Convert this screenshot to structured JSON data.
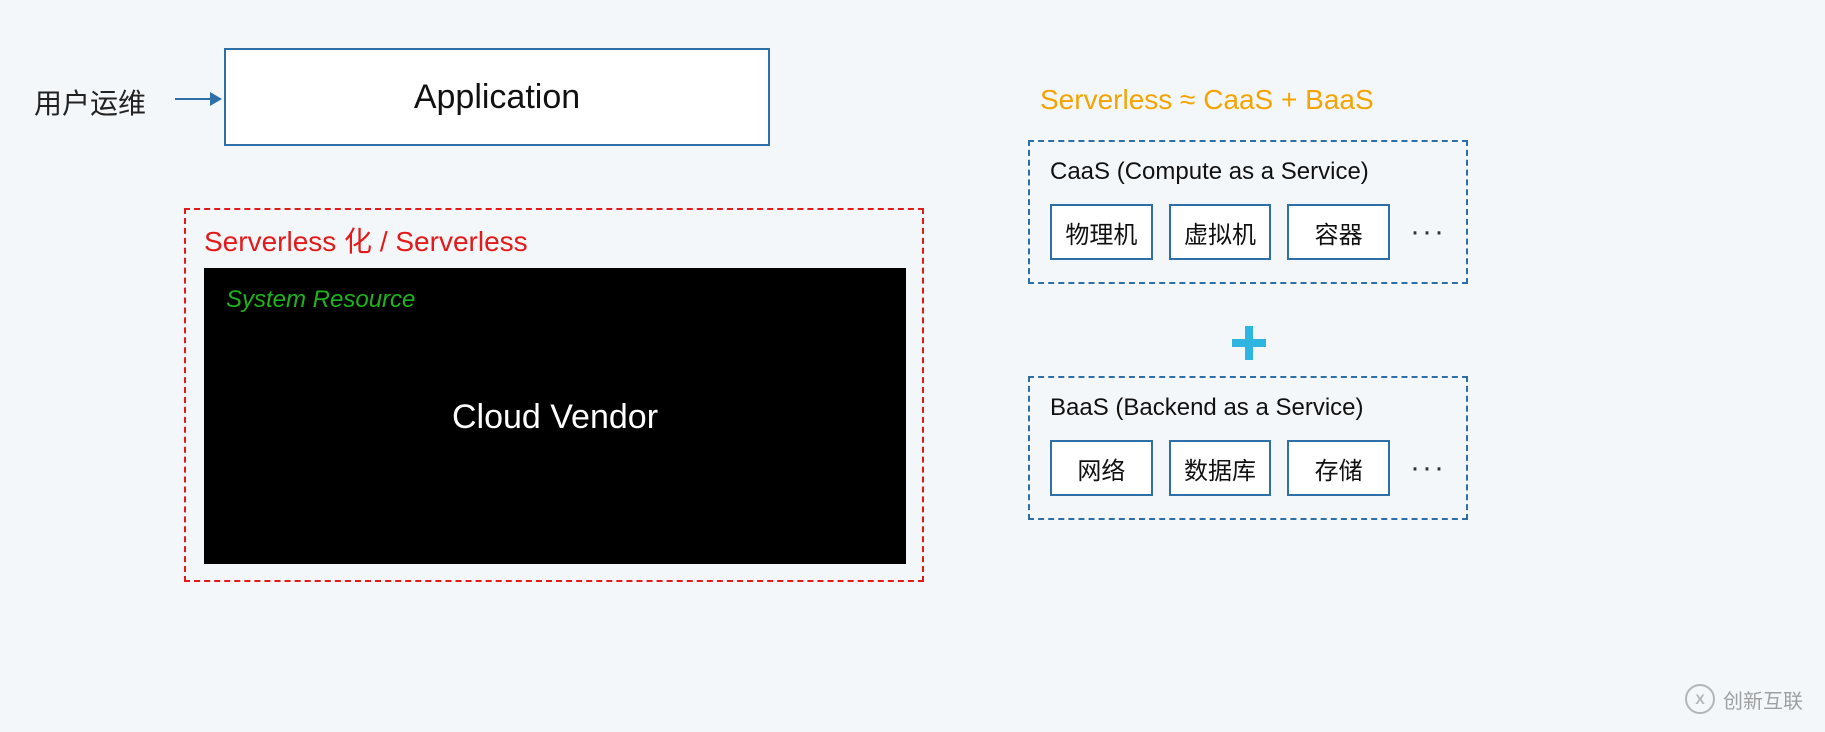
{
  "left_label": "用户运维",
  "app_box": "Application",
  "serverless_title": "Serverless 化 / Serverless",
  "system_resource": "System Resource",
  "cloud_vendor": "Cloud Vendor",
  "formula": "Serverless ≈ CaaS + BaaS",
  "caas": {
    "title": "CaaS (Compute as a Service)",
    "items": [
      "物理机",
      "虚拟机",
      "容器"
    ],
    "more": "···"
  },
  "baas": {
    "title": "BaaS (Backend as a Service)",
    "items": [
      "网络",
      "数据库",
      "存储"
    ],
    "more": "···"
  },
  "watermark": "创新互联"
}
